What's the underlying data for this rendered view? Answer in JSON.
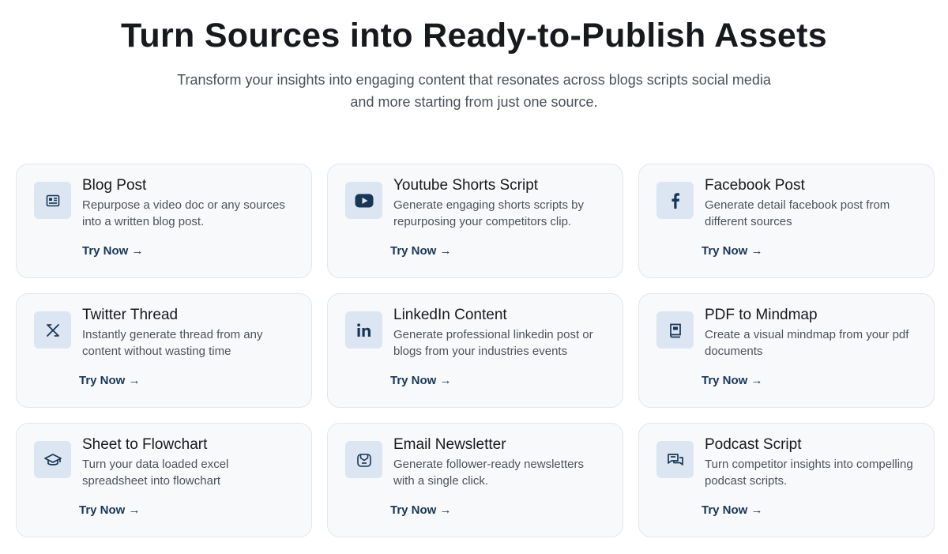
{
  "header": {
    "title": "Turn Sources into Ready-to-Publish Assets",
    "subtitle": "Transform your insights into engaging content that resonates across blogs scripts social media and more starting from just one source."
  },
  "colors": {
    "card_bg": "#f8f9fb",
    "icon_bg": "#dbe6f2",
    "accent": "#183656"
  },
  "cards": [
    {
      "icon": "newspaper-icon",
      "title": "Blog Post",
      "description": "Repurpose a video doc or any sources into a written blog post.",
      "cta": "Try Now →"
    },
    {
      "icon": "youtube-icon",
      "title": "Youtube Shorts Script",
      "description": "Generate engaging shorts scripts by repurposing your competitors clip.",
      "cta": "Try Now →"
    },
    {
      "icon": "facebook-icon",
      "title": "Facebook Post",
      "description": "Generate detail facebook post from different sources",
      "cta": "Try Now →"
    },
    {
      "icon": "x-twitter-icon",
      "title": "Twitter Thread",
      "description": "Instantly generate thread from any content without wasting time",
      "cta": "Try Now →"
    },
    {
      "icon": "linkedin-icon",
      "title": "LinkedIn Content",
      "description": "Generate professional linkedin post or blogs from your industries events",
      "cta": "Try Now →"
    },
    {
      "icon": "book-icon",
      "title": "PDF to Mindmap",
      "description": "Create a visual mindmap from your pdf documents",
      "cta": "Try Now →"
    },
    {
      "icon": "graduation-cap-icon",
      "title": "Sheet to Flowchart",
      "description": "Turn your data loaded excel spreadsheet into flowchart",
      "cta": "Try Now →"
    },
    {
      "icon": "envelope-icon",
      "title": "Email Newsletter",
      "description": "Generate follower-ready newsletters with a single click.",
      "cta": "Try Now →"
    },
    {
      "icon": "chat-bubbles-icon",
      "title": "Podcast Script",
      "description": "Turn competitor insights into compelling podcast scripts.",
      "cta": "Try Now →"
    }
  ]
}
